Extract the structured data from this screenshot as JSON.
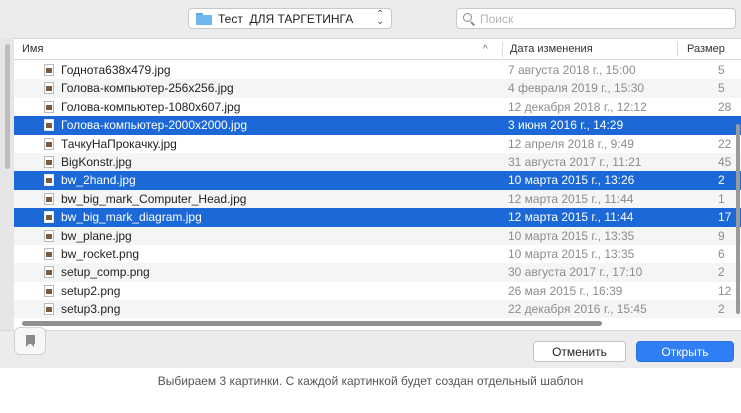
{
  "toolbar": {
    "folder_name": "Тест  ДЛЯ ТАРГЕТИНГА",
    "folder_icon": "folder-icon",
    "search_placeholder": "Поиск"
  },
  "columns": {
    "name": "Имя",
    "sort_indicator": "^",
    "date": "Дата изменения",
    "size": "Размер"
  },
  "files": [
    {
      "name": "Годнота638x479.jpg",
      "date": "7 августа 2018 г., 15:00",
      "size": "5",
      "selected": false
    },
    {
      "name": "Голова-компьютер-256x256.jpg",
      "date": "4 февраля 2019 г., 15:30",
      "size": "5",
      "selected": false
    },
    {
      "name": "Голова-компьютер-1080x607.jpg",
      "date": "12 декабря 2018 г., 12:12",
      "size": "28",
      "selected": false
    },
    {
      "name": "Голова-компьютер-2000x2000.jpg",
      "date": "3 июня 2016 г., 14:29",
      "size": "",
      "selected": true
    },
    {
      "name": "ТачкуНаПрокачку.jpg",
      "date": "12 апреля 2018 г., 9:49",
      "size": "22",
      "selected": false
    },
    {
      "name": "BigKonstr.jpg",
      "date": "31 августа 2017 г., 11:21",
      "size": "45",
      "selected": false
    },
    {
      "name": "bw_2hand.jpg",
      "date": "10 марта 2015 г., 13:26",
      "size": "2",
      "selected": true
    },
    {
      "name": "bw_big_mark_Computer_Head.jpg",
      "date": "12 марта 2015 г., 11:44",
      "size": "1",
      "selected": false
    },
    {
      "name": "bw_big_mark_diagram.jpg",
      "date": "12 марта 2015 г., 11:44",
      "size": "17",
      "selected": true
    },
    {
      "name": "bw_plane.jpg",
      "date": "10 марта 2015 г., 13:35",
      "size": "9",
      "selected": false
    },
    {
      "name": "bw_rocket.png",
      "date": "10 марта 2015 г., 13:35",
      "size": "6",
      "selected": false
    },
    {
      "name": "setup_comp.png",
      "date": "30 августа 2017 г., 17:10",
      "size": "2",
      "selected": false
    },
    {
      "name": "setup2.png",
      "date": "26 мая 2015 г., 16:39",
      "size": "12",
      "selected": false
    },
    {
      "name": "setup3.png",
      "date": "22 декабря 2016 г., 15:45",
      "size": "2",
      "selected": false
    }
  ],
  "buttons": {
    "cancel": "Отменить",
    "open": "Открыть"
  },
  "caption": "Выбираем 3 картинки. С каждой картинкой будет создан отдельный шаблон",
  "colors": {
    "selection": "#1b68d6",
    "primary_button": "#2f7ef6"
  }
}
